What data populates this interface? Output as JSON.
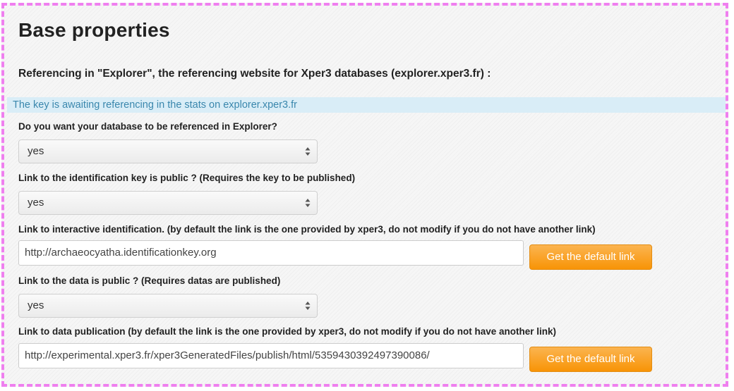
{
  "page": {
    "title": "Base properties",
    "subheading": "Referencing in \"Explorer\", the referencing website for Xper3 databases (explorer.xper3.fr) :",
    "info_text": "The key is awaiting referencing in the stats on explorer.xper3.fr"
  },
  "fields": {
    "referenced_label": "Do you want your database to be referenced in Explorer?",
    "referenced_value": "yes",
    "key_public_label": "Link to the identification key is public ? (Requires the key to be published)",
    "key_public_value": "yes",
    "interactive_link_label": "Link to interactive identification. (by default the link is the one provided by xper3, do not modify if you do not have another link)",
    "interactive_link_value": "http://archaeocyatha.identificationkey.org",
    "interactive_link_button": "Get the default link",
    "data_public_label": "Link to the data is public ? (Requires datas are published)",
    "data_public_value": "yes",
    "data_link_label": "Link to data publication (by default the link is the one provided by xper3, do not modify if you do not have another link)",
    "data_link_value": "http://experimental.xper3.fr/xper3GeneratedFiles/publish/html/5359430392497390086/",
    "data_link_button": "Get the default link"
  },
  "colors": {
    "frame_border": "#ef7fef",
    "info_background": "#d9edf7",
    "info_text": "#3a87ad",
    "button": "#f89406"
  },
  "icons": {
    "select_arrow": "up-down-arrows-icon"
  }
}
